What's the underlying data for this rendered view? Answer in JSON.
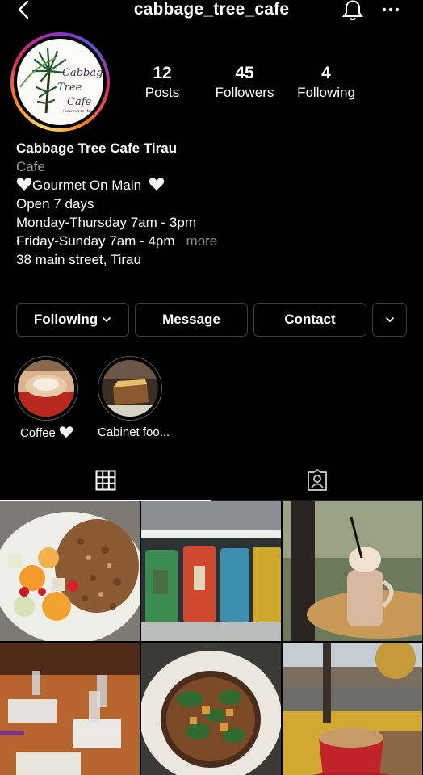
{
  "header": {
    "username": "cabbage_tree_cafe",
    "back_icon": "chevron-left-icon",
    "bell_icon": "bell-icon",
    "more_icon": "more-horizontal-icon"
  },
  "profile": {
    "logo_text": [
      "Cabbage",
      "Tree",
      "Cafe",
      "(Gourmet on Main)"
    ],
    "stats": [
      {
        "value": "12",
        "label": "Posts"
      },
      {
        "value": "45",
        "label": "Followers"
      },
      {
        "value": "4",
        "label": "Following"
      }
    ]
  },
  "bio": {
    "name": "Cabbage Tree Cafe Tirau",
    "category": "Cafe",
    "tagline": "Gourmet On Main",
    "lines": [
      "Open 7 days",
      "Monday-Thursday 7am - 3pm",
      "Friday-Sunday 7am - 4pm"
    ],
    "more": "more",
    "address": "38 main street, Tirau"
  },
  "actions": {
    "following": "Following",
    "message": "Message",
    "contact": "Contact"
  },
  "highlights": [
    {
      "label": "Coffee"
    },
    {
      "label": "Cabinet foo..."
    }
  ],
  "tabs": {
    "grid_icon": "grid-icon",
    "tagged_icon": "tagged-user-icon"
  },
  "colors": {
    "background": "#000000",
    "secondary_text": "#9a9a9a",
    "border": "#3d3d3d"
  }
}
